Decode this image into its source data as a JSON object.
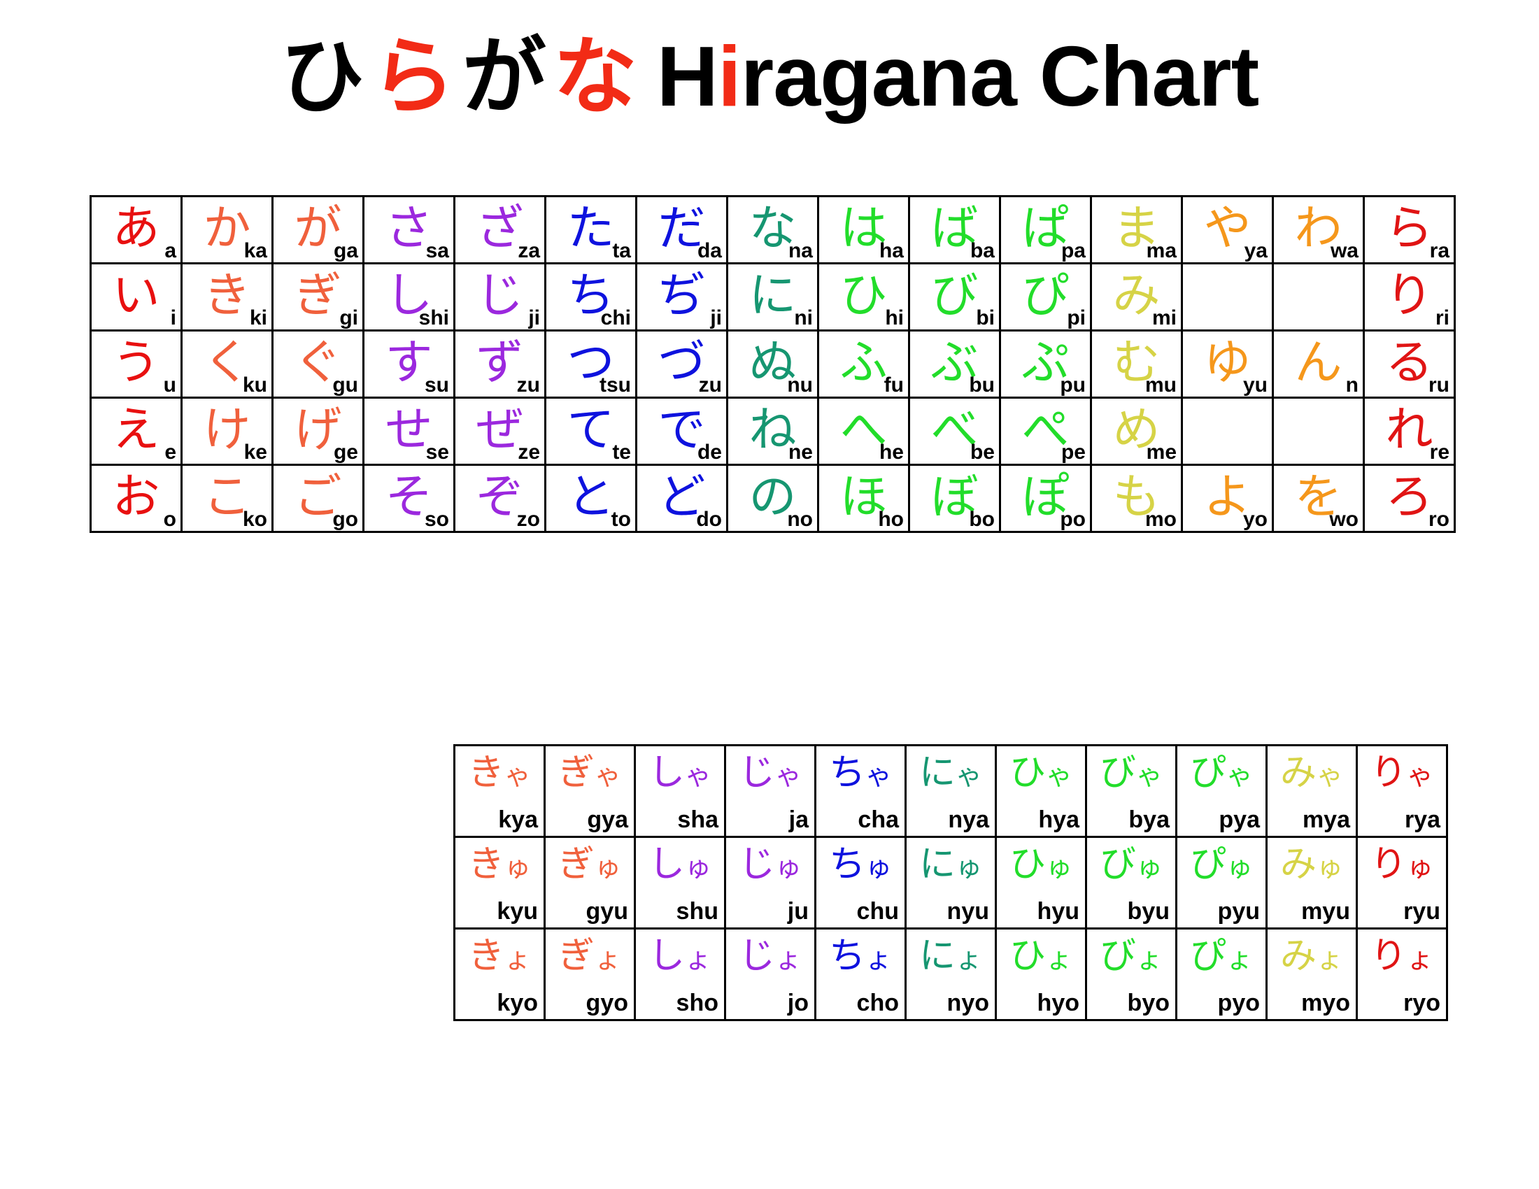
{
  "title": {
    "japanese_prefix": "ひ",
    "japanese_accent1": "ら",
    "japanese_mid": "が",
    "japanese_accent2": "な",
    "japanese_full": "ひらがな",
    "english_before_i": "H",
    "english_i": "i",
    "english_after_i": "ragana Chart",
    "english_full": "Hiragana Chart"
  },
  "palette": {
    "a_red": "#E81010",
    "ka_coral": "#F0603C",
    "sa_purple": "#9B28DE",
    "ta_blue": "#0E12DE",
    "na_teal": "#169671",
    "ha_green": "#22DD2A",
    "ma_olive": "#D6D346",
    "ya_orange": "#F5971B",
    "ra_red": "#E01414",
    "text_black": "#000000",
    "border_black": "#000000",
    "background": "#FFFFFF"
  },
  "gojuon": {
    "columns": [
      "a",
      "ka",
      "ga",
      "sa",
      "za",
      "ta",
      "da",
      "na",
      "ha",
      "ba",
      "pa",
      "ma",
      "ya",
      "wa",
      "ra"
    ],
    "rows": [
      [
        {
          "kana": "あ",
          "romaji": "a",
          "color": "#E81010"
        },
        {
          "kana": "か",
          "romaji": "ka",
          "color": "#F0603C"
        },
        {
          "kana": "が",
          "romaji": "ga",
          "color": "#F0603C"
        },
        {
          "kana": "さ",
          "romaji": "sa",
          "color": "#9B28DE"
        },
        {
          "kana": "ざ",
          "romaji": "za",
          "color": "#9B28DE"
        },
        {
          "kana": "た",
          "romaji": "ta",
          "color": "#0E12DE"
        },
        {
          "kana": "だ",
          "romaji": "da",
          "color": "#0E12DE"
        },
        {
          "kana": "な",
          "romaji": "na",
          "color": "#169671"
        },
        {
          "kana": "は",
          "romaji": "ha",
          "color": "#22DD2A"
        },
        {
          "kana": "ば",
          "romaji": "ba",
          "color": "#22DD2A"
        },
        {
          "kana": "ぱ",
          "romaji": "pa",
          "color": "#22DD2A"
        },
        {
          "kana": "ま",
          "romaji": "ma",
          "color": "#D6D346"
        },
        {
          "kana": "や",
          "romaji": "ya",
          "color": "#F5971B"
        },
        {
          "kana": "わ",
          "romaji": "wa",
          "color": "#F5971B"
        },
        {
          "kana": "ら",
          "romaji": "ra",
          "color": "#E01414"
        }
      ],
      [
        {
          "kana": "い",
          "romaji": "i",
          "color": "#E81010"
        },
        {
          "kana": "き",
          "romaji": "ki",
          "color": "#F0603C"
        },
        {
          "kana": "ぎ",
          "romaji": "gi",
          "color": "#F0603C"
        },
        {
          "kana": "し",
          "romaji": "shi",
          "color": "#9B28DE"
        },
        {
          "kana": "じ",
          "romaji": "ji",
          "color": "#9B28DE"
        },
        {
          "kana": "ち",
          "romaji": "chi",
          "color": "#0E12DE"
        },
        {
          "kana": "ぢ",
          "romaji": "ji",
          "color": "#0E12DE"
        },
        {
          "kana": "に",
          "romaji": "ni",
          "color": "#169671"
        },
        {
          "kana": "ひ",
          "romaji": "hi",
          "color": "#22DD2A"
        },
        {
          "kana": "び",
          "romaji": "bi",
          "color": "#22DD2A"
        },
        {
          "kana": "ぴ",
          "romaji": "pi",
          "color": "#22DD2A"
        },
        {
          "kana": "み",
          "romaji": "mi",
          "color": "#D6D346"
        },
        {
          "kana": "",
          "romaji": "",
          "color": ""
        },
        {
          "kana": "",
          "romaji": "",
          "color": ""
        },
        {
          "kana": "り",
          "romaji": "ri",
          "color": "#E01414"
        }
      ],
      [
        {
          "kana": "う",
          "romaji": "u",
          "color": "#E81010"
        },
        {
          "kana": "く",
          "romaji": "ku",
          "color": "#F0603C"
        },
        {
          "kana": "ぐ",
          "romaji": "gu",
          "color": "#F0603C"
        },
        {
          "kana": "す",
          "romaji": "su",
          "color": "#9B28DE"
        },
        {
          "kana": "ず",
          "romaji": "zu",
          "color": "#9B28DE"
        },
        {
          "kana": "つ",
          "romaji": "tsu",
          "color": "#0E12DE"
        },
        {
          "kana": "づ",
          "romaji": "zu",
          "color": "#0E12DE"
        },
        {
          "kana": "ぬ",
          "romaji": "nu",
          "color": "#169671"
        },
        {
          "kana": "ふ",
          "romaji": "fu",
          "color": "#22DD2A"
        },
        {
          "kana": "ぶ",
          "romaji": "bu",
          "color": "#22DD2A"
        },
        {
          "kana": "ぷ",
          "romaji": "pu",
          "color": "#22DD2A"
        },
        {
          "kana": "む",
          "romaji": "mu",
          "color": "#D6D346"
        },
        {
          "kana": "ゆ",
          "romaji": "yu",
          "color": "#F5971B"
        },
        {
          "kana": "ん",
          "romaji": "n",
          "color": "#F5971B"
        },
        {
          "kana": "る",
          "romaji": "ru",
          "color": "#E01414"
        }
      ],
      [
        {
          "kana": "え",
          "romaji": "e",
          "color": "#E81010"
        },
        {
          "kana": "け",
          "romaji": "ke",
          "color": "#F0603C"
        },
        {
          "kana": "げ",
          "romaji": "ge",
          "color": "#F0603C"
        },
        {
          "kana": "せ",
          "romaji": "se",
          "color": "#9B28DE"
        },
        {
          "kana": "ぜ",
          "romaji": "ze",
          "color": "#9B28DE"
        },
        {
          "kana": "て",
          "romaji": "te",
          "color": "#0E12DE"
        },
        {
          "kana": "で",
          "romaji": "de",
          "color": "#0E12DE"
        },
        {
          "kana": "ね",
          "romaji": "ne",
          "color": "#169671"
        },
        {
          "kana": "へ",
          "romaji": "he",
          "color": "#22DD2A"
        },
        {
          "kana": "べ",
          "romaji": "be",
          "color": "#22DD2A"
        },
        {
          "kana": "ぺ",
          "romaji": "pe",
          "color": "#22DD2A"
        },
        {
          "kana": "め",
          "romaji": "me",
          "color": "#D6D346"
        },
        {
          "kana": "",
          "romaji": "",
          "color": ""
        },
        {
          "kana": "",
          "romaji": "",
          "color": ""
        },
        {
          "kana": "れ",
          "romaji": "re",
          "color": "#E01414"
        }
      ],
      [
        {
          "kana": "お",
          "romaji": "o",
          "color": "#E81010"
        },
        {
          "kana": "こ",
          "romaji": "ko",
          "color": "#F0603C"
        },
        {
          "kana": "ご",
          "romaji": "go",
          "color": "#F0603C"
        },
        {
          "kana": "そ",
          "romaji": "so",
          "color": "#9B28DE"
        },
        {
          "kana": "ぞ",
          "romaji": "zo",
          "color": "#9B28DE"
        },
        {
          "kana": "と",
          "romaji": "to",
          "color": "#0E12DE"
        },
        {
          "kana": "ど",
          "romaji": "do",
          "color": "#0E12DE"
        },
        {
          "kana": "の",
          "romaji": "no",
          "color": "#169671"
        },
        {
          "kana": "ほ",
          "romaji": "ho",
          "color": "#22DD2A"
        },
        {
          "kana": "ぼ",
          "romaji": "bo",
          "color": "#22DD2A"
        },
        {
          "kana": "ぽ",
          "romaji": "po",
          "color": "#22DD2A"
        },
        {
          "kana": "も",
          "romaji": "mo",
          "color": "#D6D346"
        },
        {
          "kana": "よ",
          "romaji": "yo",
          "color": "#F5971B"
        },
        {
          "kana": "を",
          "romaji": "wo",
          "color": "#F5971B"
        },
        {
          "kana": "ろ",
          "romaji": "ro",
          "color": "#E01414"
        }
      ]
    ]
  },
  "yoon": {
    "columns": [
      "kya",
      "gya",
      "sha",
      "ja",
      "cha",
      "nya",
      "hya",
      "bya",
      "pya",
      "mya",
      "rya"
    ],
    "rows": [
      [
        {
          "base": "き",
          "small": "ゃ",
          "romaji": "kya",
          "color": "#F0603C"
        },
        {
          "base": "ぎ",
          "small": "ゃ",
          "romaji": "gya",
          "color": "#F0603C"
        },
        {
          "base": "し",
          "small": "ゃ",
          "romaji": "sha",
          "color": "#9B28DE"
        },
        {
          "base": "じ",
          "small": "ゃ",
          "romaji": "ja",
          "color": "#9B28DE"
        },
        {
          "base": "ち",
          "small": "ゃ",
          "romaji": "cha",
          "color": "#0E12DE"
        },
        {
          "base": "に",
          "small": "ゃ",
          "romaji": "nya",
          "color": "#169671"
        },
        {
          "base": "ひ",
          "small": "ゃ",
          "romaji": "hya",
          "color": "#22DD2A"
        },
        {
          "base": "び",
          "small": "ゃ",
          "romaji": "bya",
          "color": "#22DD2A"
        },
        {
          "base": "ぴ",
          "small": "ゃ",
          "romaji": "pya",
          "color": "#22DD2A"
        },
        {
          "base": "み",
          "small": "ゃ",
          "romaji": "mya",
          "color": "#D6D346"
        },
        {
          "base": "り",
          "small": "ゃ",
          "romaji": "rya",
          "color": "#E01414"
        }
      ],
      [
        {
          "base": "き",
          "small": "ゅ",
          "romaji": "kyu",
          "color": "#F0603C"
        },
        {
          "base": "ぎ",
          "small": "ゅ",
          "romaji": "gyu",
          "color": "#F0603C"
        },
        {
          "base": "し",
          "small": "ゅ",
          "romaji": "shu",
          "color": "#9B28DE"
        },
        {
          "base": "じ",
          "small": "ゅ",
          "romaji": "ju",
          "color": "#9B28DE"
        },
        {
          "base": "ち",
          "small": "ゅ",
          "romaji": "chu",
          "color": "#0E12DE"
        },
        {
          "base": "に",
          "small": "ゅ",
          "romaji": "nyu",
          "color": "#169671"
        },
        {
          "base": "ひ",
          "small": "ゅ",
          "romaji": "hyu",
          "color": "#22DD2A"
        },
        {
          "base": "び",
          "small": "ゅ",
          "romaji": "byu",
          "color": "#22DD2A"
        },
        {
          "base": "ぴ",
          "small": "ゅ",
          "romaji": "pyu",
          "color": "#22DD2A"
        },
        {
          "base": "み",
          "small": "ゅ",
          "romaji": "myu",
          "color": "#D6D346"
        },
        {
          "base": "り",
          "small": "ゅ",
          "romaji": "ryu",
          "color": "#E01414"
        }
      ],
      [
        {
          "base": "き",
          "small": "ょ",
          "romaji": "kyo",
          "color": "#F0603C"
        },
        {
          "base": "ぎ",
          "small": "ょ",
          "romaji": "gyo",
          "color": "#F0603C"
        },
        {
          "base": "し",
          "small": "ょ",
          "romaji": "sho",
          "color": "#9B28DE"
        },
        {
          "base": "じ",
          "small": "ょ",
          "romaji": "jo",
          "color": "#9B28DE"
        },
        {
          "base": "ち",
          "small": "ょ",
          "romaji": "cho",
          "color": "#0E12DE"
        },
        {
          "base": "に",
          "small": "ょ",
          "romaji": "nyo",
          "color": "#169671"
        },
        {
          "base": "ひ",
          "small": "ょ",
          "romaji": "hyo",
          "color": "#22DD2A"
        },
        {
          "base": "び",
          "small": "ょ",
          "romaji": "byo",
          "color": "#22DD2A"
        },
        {
          "base": "ぴ",
          "small": "ょ",
          "romaji": "pyo",
          "color": "#22DD2A"
        },
        {
          "base": "み",
          "small": "ょ",
          "romaji": "myo",
          "color": "#D6D346"
        },
        {
          "base": "り",
          "small": "ょ",
          "romaji": "ryo",
          "color": "#E01414"
        }
      ]
    ]
  }
}
